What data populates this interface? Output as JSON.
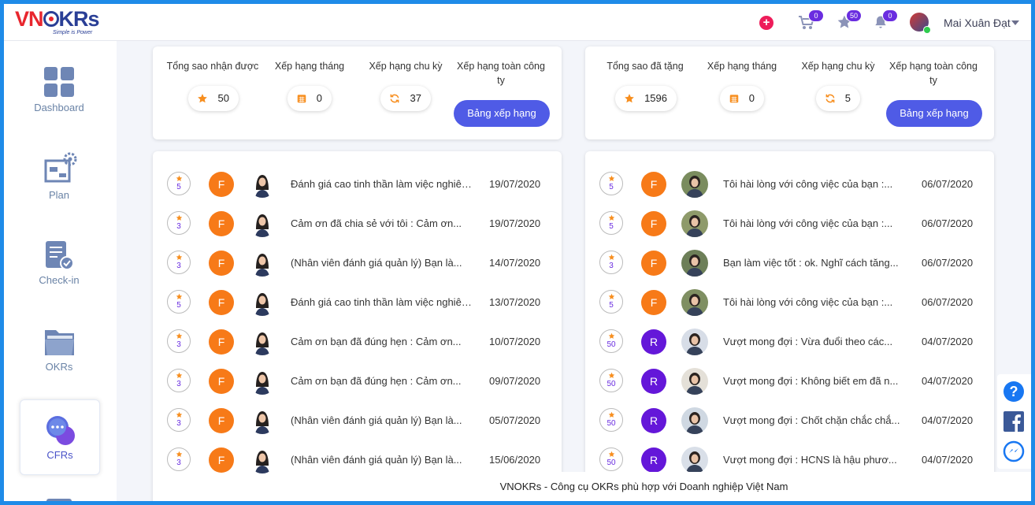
{
  "brand": {
    "logo_vn": "VN",
    "logo_okrs": "KRs",
    "logo_tagline": "Simple is Power"
  },
  "topbar": {
    "cart_count": "0",
    "stars_count": "50",
    "notifications_count": "0",
    "user_name": "Mai Xuân Đạt"
  },
  "sidebar": {
    "items": [
      {
        "label": "Dashboard",
        "icon": "dashboard-icon"
      },
      {
        "label": "Plan",
        "icon": "plan-icon"
      },
      {
        "label": "Check-in",
        "icon": "checkin-icon"
      },
      {
        "label": "OKRs",
        "icon": "okrs-folder-icon"
      },
      {
        "label": "CFRs",
        "icon": "cfrs-chat-icon",
        "active": true
      }
    ]
  },
  "received_summary": {
    "total_title": "Tổng sao nhận được",
    "total_value": "50",
    "month_title": "Xếp hạng tháng",
    "month_value": "0",
    "cycle_title": "Xếp hạng chu kỳ",
    "cycle_value": "37",
    "overall_title": "Xếp hạng toàn công ty",
    "button_label": "Bảng xếp hạng"
  },
  "given_summary": {
    "total_title": "Tổng sao đã tặng",
    "total_value": "1596",
    "month_title": "Xếp hạng tháng",
    "month_value": "0",
    "cycle_title": "Xếp hạng chu kỳ",
    "cycle_value": "5",
    "overall_title": "Xếp hạng toàn công ty",
    "button_label": "Bảng xếp hạng"
  },
  "received_list": [
    {
      "stars": "5",
      "type": "F",
      "message": "Đánh giá cao tinh thần làm việc nghiêm túc với ng...",
      "date": "19/07/2020"
    },
    {
      "stars": "3",
      "type": "F",
      "message": "Cảm ơn đã chia sẻ với tôi : Cảm ơn...",
      "date": "19/07/2020"
    },
    {
      "stars": "3",
      "type": "F",
      "message": "(Nhân viên đánh giá quản lý) Bạn là...",
      "date": "14/07/2020"
    },
    {
      "stars": "5",
      "type": "F",
      "message": "Đánh giá cao tinh thần làm việc nghiêm túc với ng...",
      "date": "13/07/2020"
    },
    {
      "stars": "3",
      "type": "F",
      "message": "Cảm ơn bạn đã đúng hẹn : Cảm ơn...",
      "date": "10/07/2020"
    },
    {
      "stars": "3",
      "type": "F",
      "message": "Cảm ơn bạn đã đúng hẹn : Cảm ơn...",
      "date": "09/07/2020"
    },
    {
      "stars": "3",
      "type": "F",
      "message": "(Nhân viên đánh giá quản lý) Bạn là...",
      "date": "05/07/2020"
    },
    {
      "stars": "3",
      "type": "F",
      "message": "(Nhân viên đánh giá quản lý) Bạn là...",
      "date": "15/06/2020"
    }
  ],
  "given_list": [
    {
      "stars": "5",
      "type": "F",
      "message": "Tôi hài lòng với công việc của bạn :...",
      "date": "06/07/2020"
    },
    {
      "stars": "5",
      "type": "F",
      "message": "Tôi hài lòng với công việc của bạn :...",
      "date": "06/07/2020"
    },
    {
      "stars": "3",
      "type": "F",
      "message": "Bạn làm việc tốt : ok. Nghĩ cách tăng...",
      "date": "06/07/2020"
    },
    {
      "stars": "5",
      "type": "F",
      "message": "Tôi hài lòng với công việc của bạn :...",
      "date": "06/07/2020"
    },
    {
      "stars": "50",
      "type": "R",
      "message": "Vượt mong đợi : Vừa đuổi theo các...",
      "date": "04/07/2020"
    },
    {
      "stars": "50",
      "type": "R",
      "message": "Vượt mong đợi : Không biết em đã n...",
      "date": "04/07/2020"
    },
    {
      "stars": "50",
      "type": "R",
      "message": "Vượt mong đợi : Chốt chặn chắc chắ...",
      "date": "04/07/2020"
    },
    {
      "stars": "50",
      "type": "R",
      "message": "Vượt mong đợi : HCNS là hậu phươ...",
      "date": "04/07/2020"
    }
  ],
  "footer": {
    "text": "VNOKRs - Công cụ OKRs phù hợp với Doanh nghiệp Việt Nam"
  },
  "colors": {
    "accent": "#4f5be6",
    "feedback_orange": "#f77a18",
    "recognition_purple": "#6417d9",
    "frame_blue": "#1f8be8"
  }
}
